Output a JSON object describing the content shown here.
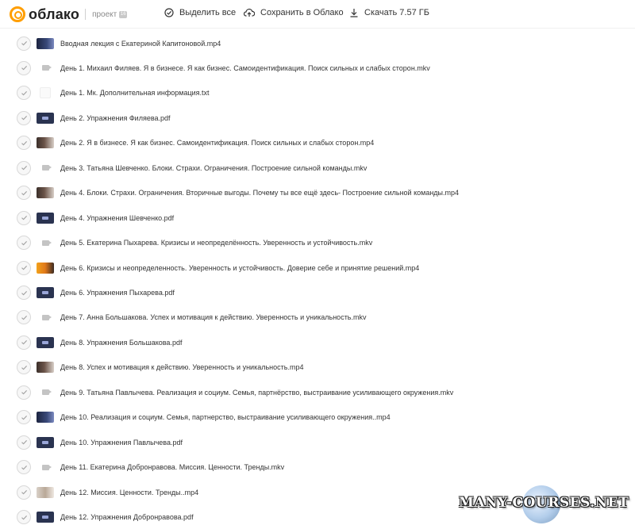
{
  "header": {
    "logo_text": "облако",
    "project_label": "проект",
    "project_badge": "16",
    "select_all_label": "Выделить все",
    "save_label": "Сохранить в Облако",
    "download_label": "Скачать 7.57 ГБ"
  },
  "files": [
    {
      "name": "Вводная лекция с Екатериной Капитоновой.mp4",
      "thumb": "mp4-blue"
    },
    {
      "name": "День 1. Михаил Филяев. Я в бизнесе. Я как бизнес. Самоидентификация. Поиск сильных и слабых сторон.mkv",
      "thumb": "video"
    },
    {
      "name": "День 1. Мк. Дополнительная информация.txt",
      "thumb": "text"
    },
    {
      "name": "День 2. Упражнения Филяева.pdf",
      "thumb": "pdf"
    },
    {
      "name": "День 2. Я в бизнесе. Я как бизнес. Самоидентификация. Поиск сильных и слабых сторон.mp4",
      "thumb": "mp4"
    },
    {
      "name": "День 3. Татьяна Шевченко. Блоки. Страхи. Ограничения. Построение сильной команды.mkv",
      "thumb": "video"
    },
    {
      "name": "День 4. Блоки. Страхи. Ограничения. Вторичные выгоды. Почему ты все ещё здесь- Построение сильной команды.mp4",
      "thumb": "mp4"
    },
    {
      "name": "День 4. Упражнения Шевченко.pdf",
      "thumb": "pdf"
    },
    {
      "name": "День 5. Екатерина Пыхарева. Кризисы и неопределённость. Уверенность и устойчивость.mkv",
      "thumb": "video"
    },
    {
      "name": "День 6. Кризисы и неопределенность. Уверенность и устойчивость. Доверие себе и принятие решений.mp4",
      "thumb": "mp4-orange"
    },
    {
      "name": "День 6. Упражнения Пыхарева.pdf",
      "thumb": "pdf"
    },
    {
      "name": "День 7. Анна Большакова. Успех и мотивация к действию. Уверенность и уникальность.mkv",
      "thumb": "video"
    },
    {
      "name": "День 8. Упражнения Большакова.pdf",
      "thumb": "pdf"
    },
    {
      "name": "День 8. Успех и мотивация к действию. Уверенность и уникальность.mp4",
      "thumb": "mp4"
    },
    {
      "name": "День 9. Татьяна Павлычева. Реализация и социум. Семья, партнёрство, выстраивание усиливающего окружения.mkv",
      "thumb": "video"
    },
    {
      "name": "День 10. Реализация и социум. Семья, партнерство, выстраивание усиливающего окружения..mp4",
      "thumb": "mp4-blue"
    },
    {
      "name": "День 10. Упражнения Павлычева.pdf",
      "thumb": "pdf"
    },
    {
      "name": "День 11. Екатерина Добронравова. Миссия. Ценности. Тренды.mkv",
      "thumb": "video"
    },
    {
      "name": "День 12. Миссия. Ценности. Тренды..mp4",
      "thumb": "mp4-light"
    },
    {
      "name": "День 12. Упражнения Добронравова.pdf",
      "thumb": "pdf"
    }
  ],
  "watermark": {
    "text": "MANY-COURSES.NET"
  },
  "colors": {
    "accent": "#ff9e00",
    "text": "#333333",
    "muted": "#8a8a8a"
  }
}
